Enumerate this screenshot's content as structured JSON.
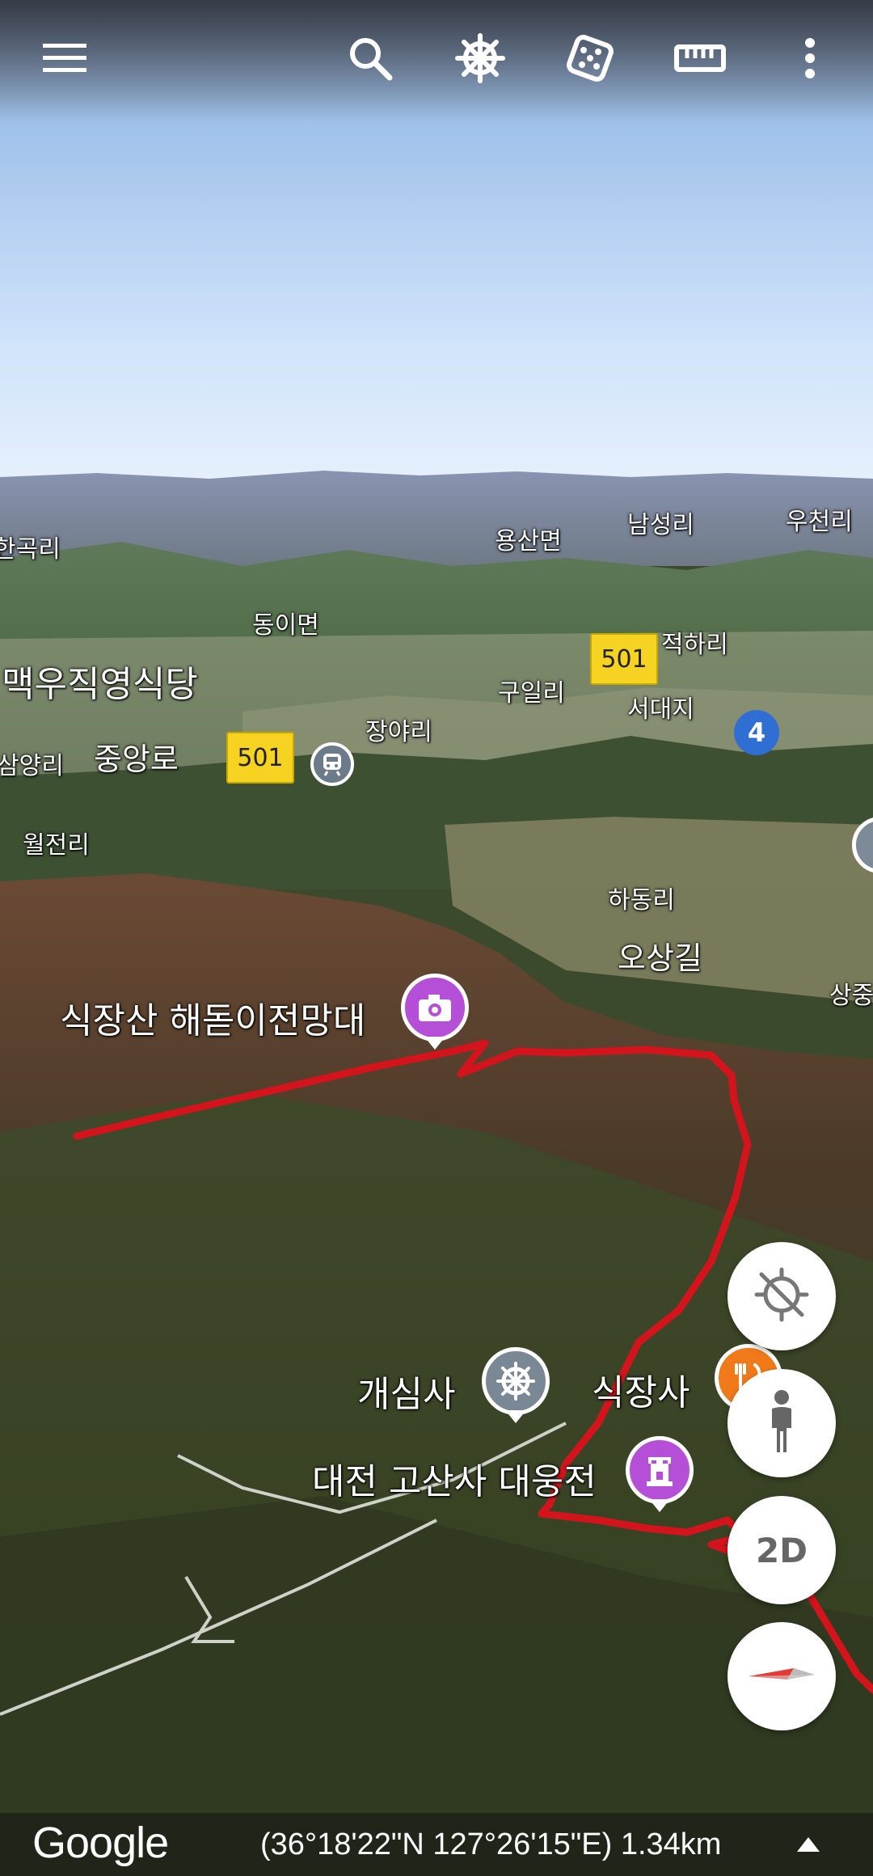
{
  "toolbar": {
    "menu_icon": "menu-icon",
    "search_icon": "search-icon",
    "voyager_icon": "voyager-helm-icon",
    "feeling_lucky_icon": "dice-icon",
    "measure_icon": "ruler-icon",
    "more_icon": "more-vert-icon"
  },
  "map": {
    "place_labels": {
      "hangok": "한곡리",
      "yongsan": "용산면",
      "namseong": "남성리",
      "ucheon": "우천리",
      "dongi": "동이면",
      "jeokha": "적하리",
      "restaurant": "맥우직영식당",
      "guil": "구일리",
      "seodae": "서대지",
      "jangya": "장야리",
      "samyang": "삼양리",
      "jungang": "중앙로",
      "woljeon": "월전리",
      "hadong": "하동리",
      "osang": "오상길",
      "sangjung": "상중",
      "observatory": "식장산 해돋이전망대",
      "gaesimsa": "개심사",
      "sikjangsa": "식장사",
      "gosansa": "대전 고산사 대웅전"
    },
    "route_shields": {
      "r501_a": "501",
      "r501_b": "501",
      "r4": "4"
    },
    "route_color": "#d4141c"
  },
  "controls": {
    "recenter_icon": "location-off-icon",
    "street_view_icon": "pegman-icon",
    "view_mode_label": "2D",
    "compass_icon": "compass-icon"
  },
  "footer": {
    "logo": "Google",
    "coordinates": "(36°18'22\"N 127°26'15\"E) 1.34km",
    "expand_icon": "triangle-up-icon"
  }
}
